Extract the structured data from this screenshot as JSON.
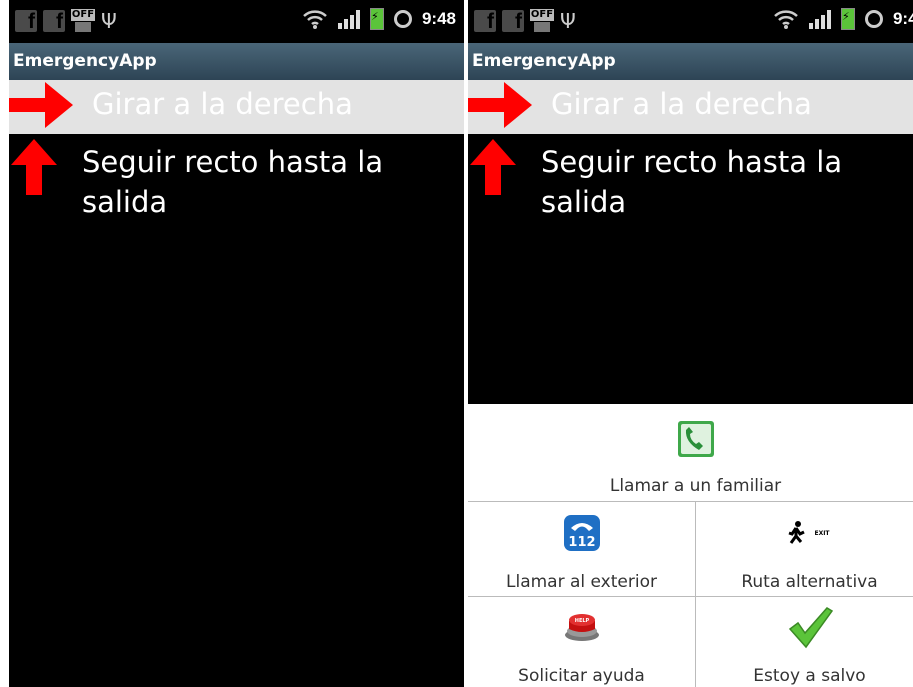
{
  "status_bar": {
    "time": "9:48",
    "off_badge": "OFF",
    "usb": "Ψ",
    "fb_glyph": "f"
  },
  "app": {
    "title": "EmergencyApp"
  },
  "directions": {
    "current": "Girar a la derecha",
    "next": "Seguir recto hasta la salida"
  },
  "menu": {
    "call_family": "Llamar a un familiar",
    "call_outside": "Llamar al exterior",
    "alt_route": "Ruta alternativa",
    "request_help": "Solicitar ayuda",
    "safe": "Estoy a salvo",
    "call_outside_number": "112",
    "exit_sign": "EXIT",
    "help_button": "HELP"
  },
  "colors": {
    "accent_red": "#ff0000",
    "titlebar": "#3a5567",
    "highlight_row": "#e3e3e3"
  }
}
